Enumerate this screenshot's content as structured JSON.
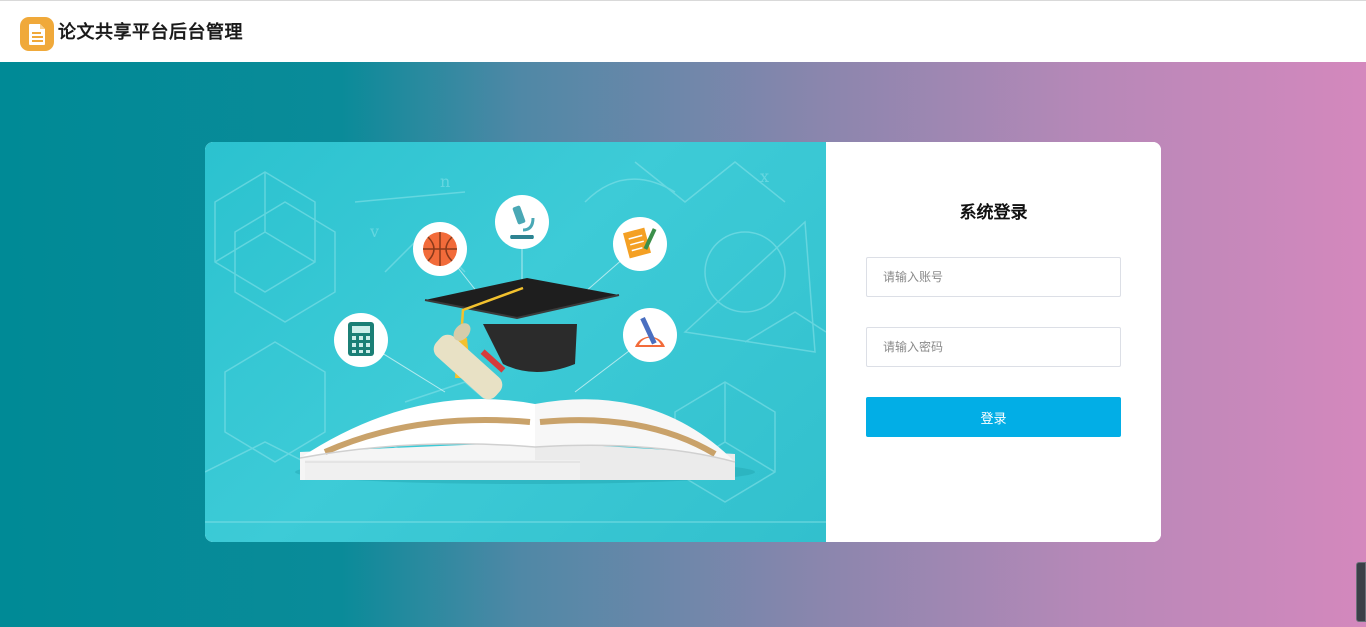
{
  "header": {
    "app_title": "论文共享平台后台管理",
    "logo_icon": "document-icon",
    "logo_color": "#f0a93a"
  },
  "background": {
    "gradient_start": "#008a96",
    "gradient_end": "#d488bd"
  },
  "login": {
    "title": "系统登录",
    "account_placeholder": "请输入账号",
    "password_placeholder": "请输入密码",
    "submit_label": "登录",
    "button_color": "#02aee6"
  },
  "illustration": {
    "icons": [
      "basketball-icon",
      "microscope-icon",
      "notebook-icon",
      "calculator-icon",
      "protractor-icon",
      "graduation-cap-icon",
      "open-book-icon",
      "diploma-icon"
    ]
  }
}
